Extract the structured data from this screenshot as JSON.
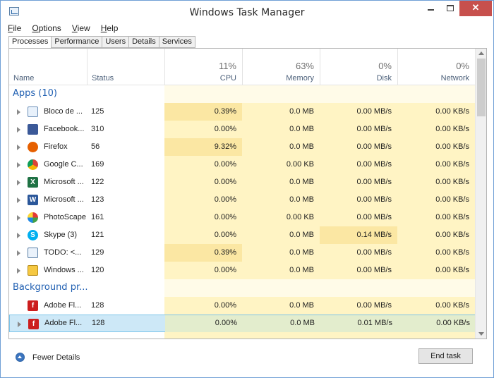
{
  "window": {
    "title": "Windows Task Manager",
    "close_glyph": "✕"
  },
  "menu": [
    {
      "mnemonic": "F",
      "rest": "ile"
    },
    {
      "mnemonic": "O",
      "rest": "ptions"
    },
    {
      "mnemonic": "V",
      "rest": "iew"
    },
    {
      "mnemonic": "H",
      "rest": "elp"
    }
  ],
  "tabs": [
    "Processes",
    "Performance",
    "Users",
    "Details",
    "Services"
  ],
  "columns": {
    "name": "Name",
    "status": "Status",
    "cpu": {
      "pct": "11%",
      "label": "CPU"
    },
    "memory": {
      "pct": "63%",
      "label": "Memory"
    },
    "disk": {
      "pct": "0%",
      "label": "Disk"
    },
    "network": {
      "pct": "0%",
      "label": "Network"
    }
  },
  "groups": {
    "apps": "Apps (10)",
    "background": "Background pr..."
  },
  "rows": [
    {
      "icon": "notepad-icon",
      "name": "Bloco de ...",
      "status": "125",
      "cpu": "0.39%",
      "memory": "0.0 MB",
      "disk": "0.00 MB/s",
      "network": "0.00 KB/s"
    },
    {
      "icon": "facebook-icon",
      "name": "Facebook...",
      "status": "310",
      "cpu": "0.00%",
      "memory": "0.0 MB",
      "disk": "0.00 MB/s",
      "network": "0.00 KB/s"
    },
    {
      "icon": "firefox-icon",
      "name": "Firefox",
      "status": "56",
      "cpu": "9.32%",
      "memory": "0.0 MB",
      "disk": "0.00 MB/s",
      "network": "0.00 KB/s"
    },
    {
      "icon": "chrome-icon",
      "name": "Google C...",
      "status": "169",
      "cpu": "0.00%",
      "memory": "0.00 KB",
      "disk": "0.00 MB/s",
      "network": "0.00 KB/s"
    },
    {
      "icon": "excel-icon",
      "name": "Microsoft ...",
      "status": "122",
      "cpu": "0.00%",
      "memory": "0.0 MB",
      "disk": "0.00 MB/s",
      "network": "0.00 KB/s"
    },
    {
      "icon": "word-icon",
      "name": "Microsoft ...",
      "status": "123",
      "cpu": "0.00%",
      "memory": "0.0 MB",
      "disk": "0.00 MB/s",
      "network": "0.00 KB/s"
    },
    {
      "icon": "photoscape-icon",
      "name": "PhotoScape",
      "status": "161",
      "cpu": "0.00%",
      "memory": "0.00 KB",
      "disk": "0.00 MB/s",
      "network": "0.00 KB/s"
    },
    {
      "icon": "skype-icon",
      "name": "Skype  (3)",
      "status": "121",
      "cpu": "0.00%",
      "memory": "0.0 MB",
      "disk": "0.14 MB/s",
      "network": "0.00 KB/s"
    },
    {
      "icon": "taskmanager-icon",
      "name": "TODO: <...",
      "status": "129",
      "cpu": "0.39%",
      "memory": "0.0 MB",
      "disk": "0.00 MB/s",
      "network": "0.00 KB/s"
    },
    {
      "icon": "explorer-icon",
      "name": "Windows ...",
      "status": "120",
      "cpu": "0.00%",
      "memory": "0.0 MB",
      "disk": "0.00 MB/s",
      "network": "0.00 KB/s"
    },
    {
      "icon": "flash-icon",
      "name": "Adobe Fl...",
      "status": "128",
      "cpu": "0.00%",
      "memory": "0.0 MB",
      "disk": "0.00 MB/s",
      "network": "0.00 KB/s"
    },
    {
      "icon": "flash-icon",
      "name": "Adobe Fl...",
      "status": "128",
      "cpu": "0.00%",
      "memory": "0.0 MB",
      "disk": "0.01 MB/s",
      "network": "0.00 KB/s"
    }
  ],
  "footer": {
    "fewer_details": "Fewer Details",
    "end_task": "End task"
  },
  "colors": {
    "accent": "#2160b2",
    "close": "#c7504d",
    "heat_low": "#fff4c4",
    "heat_mid": "#fbe7a3",
    "selected": "#cde8f7"
  }
}
